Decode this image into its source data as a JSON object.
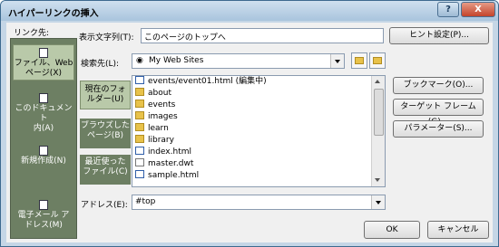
{
  "window": {
    "title": "ハイパーリンクの挿入",
    "help_label": "?",
    "close_label": "X"
  },
  "labels": {
    "link_to": "リンク先:",
    "display_text": "表示文字列(T):",
    "search_in": "検索先(L):",
    "address": "アドレス(E):"
  },
  "fields": {
    "display_text_value": "このページのトップへ",
    "search_in_value": "My Web Sites",
    "address_value": "#top"
  },
  "link_types": [
    {
      "label1": "ファイル、Web",
      "label2": "ページ(X)"
    },
    {
      "label1": "このドキュメント",
      "label2": "内(A)"
    },
    {
      "label1": "新規作成(N)",
      "label2": ""
    },
    {
      "label1": "電子メール ア",
      "label2": "ドレス(M)"
    }
  ],
  "sub_tabs": [
    {
      "label1": "現在のフォ",
      "label2": "ルダー(U)"
    },
    {
      "label1": "ブラウズした",
      "label2": "ページ(B)"
    },
    {
      "label1": "最近使った",
      "label2": "ファイル(C)"
    }
  ],
  "files": [
    {
      "name": "events/event01.html (編集中)",
      "icon": "html-file-icon"
    },
    {
      "name": "about",
      "icon": "folder-icon"
    },
    {
      "name": "events",
      "icon": "folder-icon"
    },
    {
      "name": "images",
      "icon": "folder-icon"
    },
    {
      "name": "learn",
      "icon": "folder-icon"
    },
    {
      "name": "library",
      "icon": "folder-icon"
    },
    {
      "name": "index.html",
      "icon": "html-file-icon"
    },
    {
      "name": "master.dwt",
      "icon": "file-icon"
    },
    {
      "name": "sample.html",
      "icon": "html-file-icon"
    }
  ],
  "buttons": {
    "hint": "ヒント設定(P)...",
    "bookmark": "ブックマーク(O)...",
    "target_frame": "ターゲット フレーム(G)...",
    "parameters": "パラメーター(S)...",
    "ok": "OK",
    "cancel": "キャンセル"
  },
  "colors": {
    "left_bar": "#6d7f63",
    "left_bar_selected": "#b9c9a9",
    "title_bar": "#a9c4dd"
  }
}
